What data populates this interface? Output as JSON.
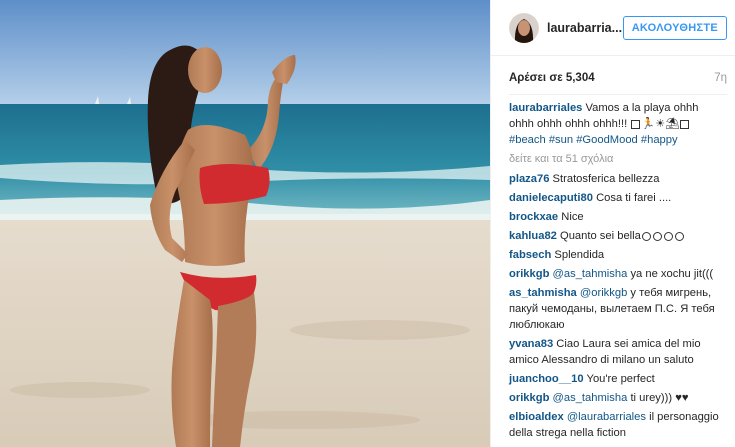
{
  "post": {
    "username": "laurabarria...",
    "follow_label": "ΑΚΟΛΟΥΘΗΣΤΕ",
    "likes_label": "Αρέσει σε 5,304",
    "time_ago": "7η"
  },
  "caption": {
    "user": "laurabarriales",
    "text": "Vamos a la playa ohhh ohhh ohhh ohhh ohhh!!!",
    "tags": [
      "#beach",
      "#sun",
      "#GoodMood",
      "#happy"
    ]
  },
  "view_all": "δείτε και τα 51 σχόλια",
  "comments": [
    {
      "user": "plaza76",
      "text": "Stratosferica bellezza"
    },
    {
      "user": "danielecaputi80",
      "text": "Cosa ti farei ...."
    },
    {
      "user": "brockxae",
      "text": "Nice"
    },
    {
      "user": "kahlua82",
      "text": "Quanto sei bella"
    },
    {
      "user": "fabsech",
      "text": "Splendida"
    },
    {
      "user": "orikkgb",
      "mention": "@as_tahmisha",
      "text": "ya ne xochu jit((("
    },
    {
      "user": "as_tahmisha",
      "mention": "@orikkgb",
      "text": "у тебя мигрень, пакуй чемоданы, вылетаем П.С. Я тебя люблюкаю"
    },
    {
      "user": "yvana83",
      "text": "Ciao Laura sei amica del mio amico Alessandro di milano un saluto"
    },
    {
      "user": "juanchoo__10",
      "text": "You're perfect"
    },
    {
      "user": "orikkgb",
      "mention": "@as_tahmisha",
      "text": "ti urey))) ♥♥"
    },
    {
      "user": "elbioaldex",
      "mention": "@laurabarriales",
      "text": "il personaggio della strega nella fiction"
    }
  ]
}
